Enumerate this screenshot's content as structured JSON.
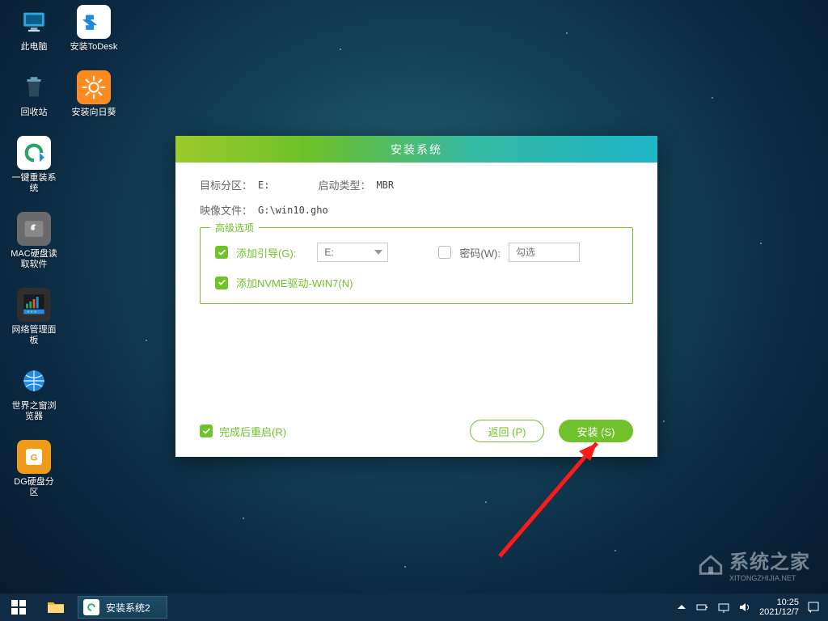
{
  "desktop": {
    "icons_col1": [
      {
        "label": "此电脑",
        "name": "this-pc"
      },
      {
        "label": "回收站",
        "name": "recycle-bin"
      },
      {
        "label": "一键重装系统",
        "name": "one-click-reinstall"
      },
      {
        "label": "MAC硬盘读取软件",
        "name": "mac-disk-reader"
      },
      {
        "label": "网络管理面板",
        "name": "network-panel"
      },
      {
        "label": "世界之窗浏览器",
        "name": "theworld-browser"
      },
      {
        "label": "DG硬盘分区",
        "name": "diskgenius"
      }
    ],
    "icons_col2": [
      {
        "label": "安装ToDesk",
        "name": "install-todesk"
      },
      {
        "label": "安装向日葵",
        "name": "install-sunlogin"
      }
    ]
  },
  "dialog": {
    "title": "安装系统",
    "target_label": "目标分区：",
    "target_value": "E:",
    "boot_label": "启动类型：",
    "boot_value": "MBR",
    "image_label": "映像文件：",
    "image_value": "G:\\win10.gho",
    "advanced_legend": "高级选项",
    "add_boot_label": "添加引导(G):",
    "add_boot_select": "E:",
    "password_label": "密码(W):",
    "password_placeholder": "勾选",
    "add_nvme_label": "添加NVME驱动-WIN7(N)",
    "restart_label": "完成后重启(R)",
    "back_btn": "返回 (P)",
    "install_btn": "安装 (S)"
  },
  "taskbar": {
    "active_task": "安装系统2",
    "time": "10:25",
    "date": "2021/12/7"
  },
  "watermark": {
    "text": "系统之家",
    "sub": "XITONGZHIJIA.NET"
  }
}
